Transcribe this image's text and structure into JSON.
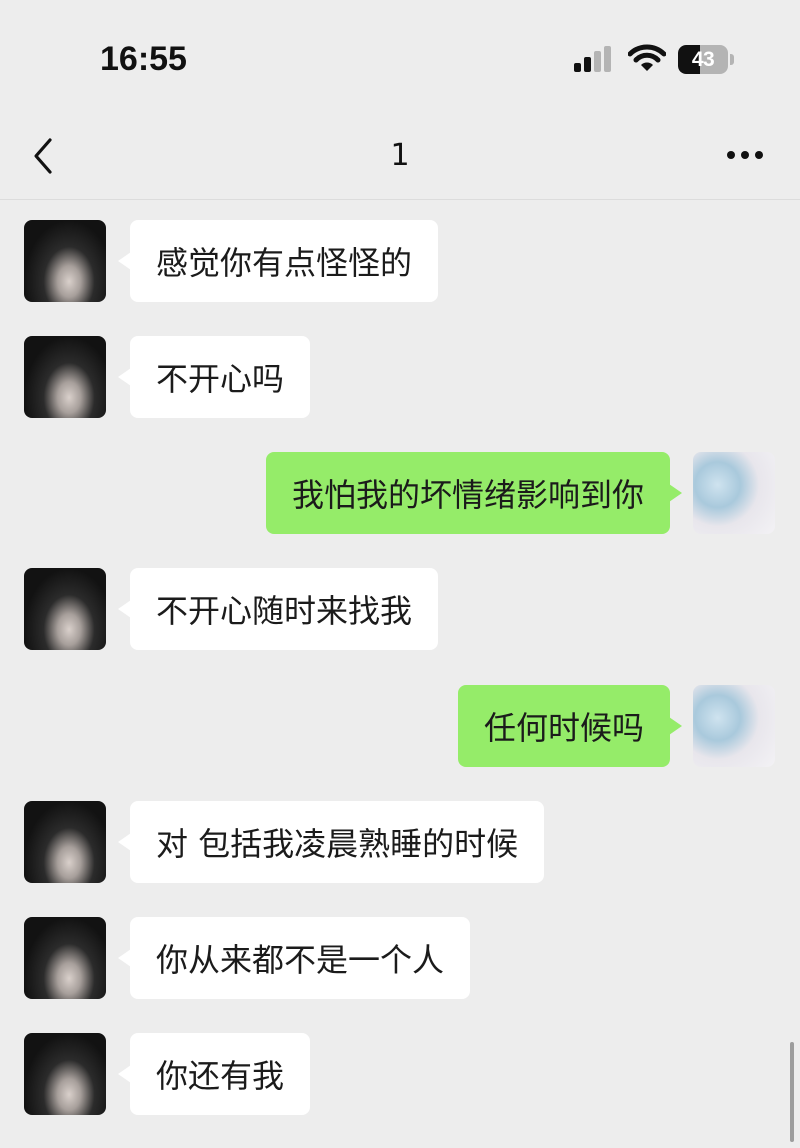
{
  "status_bar": {
    "time": "16:55",
    "battery_level": "43",
    "battery_fraction": 0.43,
    "signal_icon": "cellular-signal-icon",
    "wifi_icon": "wifi-icon"
  },
  "nav": {
    "title": "1",
    "back_icon": "chevron-left-icon",
    "more_icon": "more-dots-icon"
  },
  "colors": {
    "background": "#ededed",
    "incoming_bubble": "#ffffff",
    "outgoing_bubble": "#95ec69"
  },
  "messages": [
    {
      "side": "left",
      "text": "感觉你有点怪怪的"
    },
    {
      "side": "left",
      "text": "不开心吗"
    },
    {
      "side": "right",
      "text": "我怕我的坏情绪影响到你"
    },
    {
      "side": "left",
      "text": "不开心随时来找我"
    },
    {
      "side": "right",
      "text": "任何时候吗"
    },
    {
      "side": "left",
      "text": "对 包括我凌晨熟睡的时候"
    },
    {
      "side": "left",
      "text": "你从来都不是一个人"
    },
    {
      "side": "left",
      "text": "你还有我"
    }
  ]
}
